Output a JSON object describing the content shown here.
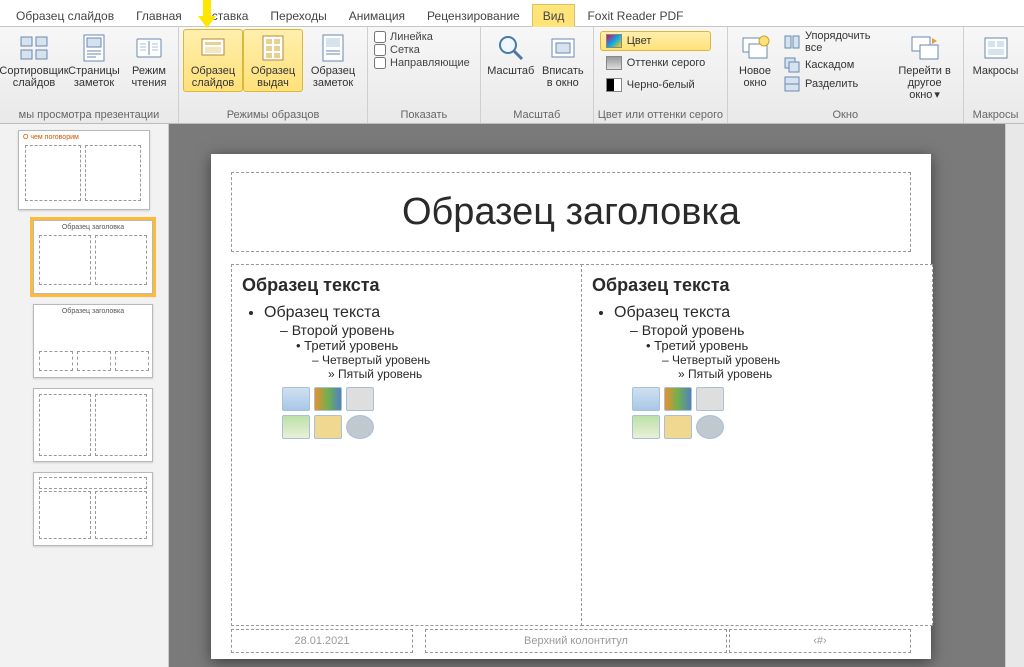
{
  "tabs": {
    "slide_master": "Образец слайдов",
    "home": "Главная",
    "insert": "Вставка",
    "transitions": "Переходы",
    "animations": "Анимация",
    "review": "Рецензирование",
    "view": "Вид",
    "foxit": "Foxit Reader PDF"
  },
  "ribbon": {
    "group_views": {
      "label": "мы просмотра презентации",
      "slide_sorter": "Сортировщик слайдов",
      "notes_page": "Страницы заметок",
      "reading": "Режим чтения"
    },
    "group_master": {
      "label": "Режимы образцов",
      "slide_master": "Образец слайдов",
      "handout": "Образец выдач",
      "notes": "Образец заметок"
    },
    "group_show": {
      "label": "Показать",
      "ruler": "Линейка",
      "grid": "Сетка",
      "guides": "Направляющие"
    },
    "group_zoom": {
      "label": "Масштаб",
      "zoom": "Масштаб",
      "fit": "Вписать в окно"
    },
    "group_color": {
      "label": "Цвет или оттенки серого",
      "color": "Цвет",
      "gray": "Оттенки серого",
      "bw": "Черно-белый"
    },
    "group_window": {
      "label": "Окно",
      "new_window": "Новое окно",
      "arrange": "Упорядочить все",
      "cascade": "Каскадом",
      "split": "Разделить",
      "switch": "Перейти в другое окно"
    },
    "group_macros": {
      "label": "Макросы",
      "macros": "Макросы"
    }
  },
  "thumbs": {
    "master_title": "О чем поговорим",
    "layout_title": "Образец заголовка"
  },
  "slide": {
    "title": "Образец заголовка",
    "body_head": "Образец текста",
    "l1": "Образец текста",
    "l2": "Второй уровень",
    "l3": "Третий уровень",
    "l4": "Четвертый уровень",
    "l5": "Пятый уровень",
    "date": "28.01.2021",
    "footer": "Верхний колонтитул",
    "num": "‹#›"
  }
}
